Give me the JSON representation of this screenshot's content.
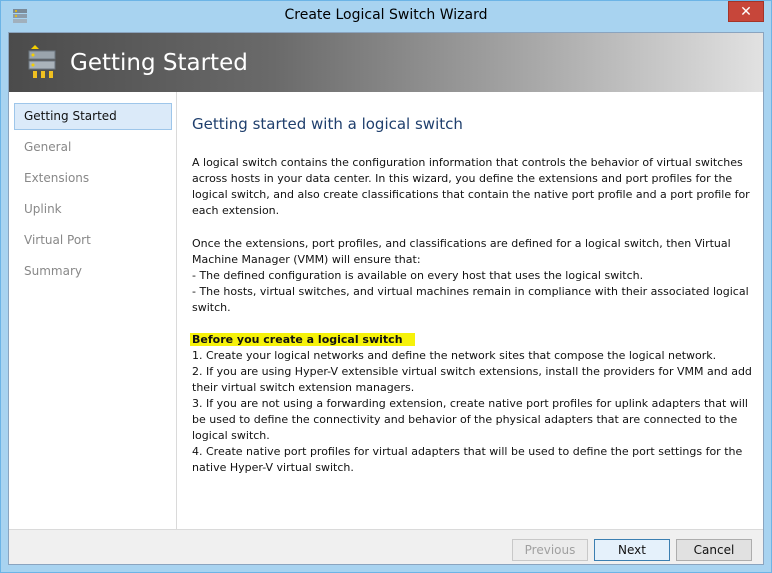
{
  "window": {
    "title": "Create Logical Switch Wizard",
    "close_label": "✕"
  },
  "header": {
    "title": "Getting Started"
  },
  "sidebar": {
    "items": [
      {
        "label": "Getting Started",
        "active": true
      },
      {
        "label": "General"
      },
      {
        "label": "Extensions"
      },
      {
        "label": "Uplink"
      },
      {
        "label": "Virtual Port"
      },
      {
        "label": "Summary"
      }
    ]
  },
  "main": {
    "heading": "Getting started with a logical switch",
    "para1": "A logical switch contains the configuration information that controls the behavior of virtual switches across hosts in your data center. In this wizard, you define the extensions and port profiles for the logical switch, and also create classifications that contain the native port profile and a port profile for each extension.",
    "para2_intro": "Once the extensions, port profiles, and classifications are defined for a logical switch, then Virtual Machine Manager (VMM) will ensure that:",
    "para2_item1": "- The defined configuration is available on every host that uses the logical switch.",
    "para2_item2": "- The hosts, virtual switches, and virtual machines remain in compliance with their associated logical switch.",
    "before_heading": "Before you create a logical switch",
    "step1": "1. Create your logical networks and define the network sites that compose the logical network.",
    "step2": "2. If you are using Hyper-V extensible virtual switch extensions, install the providers for VMM and add their virtual switch extension managers.",
    "step3": "3. If you are not using a forwarding extension, create native port profiles for uplink adapters that will be used to define the connectivity and behavior of the physical adapters that are connected to the logical switch.",
    "step4": "4. Create native port profiles for virtual adapters that will be used to define the port settings for the native Hyper-V virtual switch."
  },
  "footer": {
    "previous_label": "Previous",
    "next_label": "Next",
    "cancel_label": "Cancel"
  },
  "colors": {
    "title_bar": "#a8d3f0",
    "heading": "#1f3f6d",
    "highlight": "#f6f20a",
    "close": "#c7463a"
  }
}
